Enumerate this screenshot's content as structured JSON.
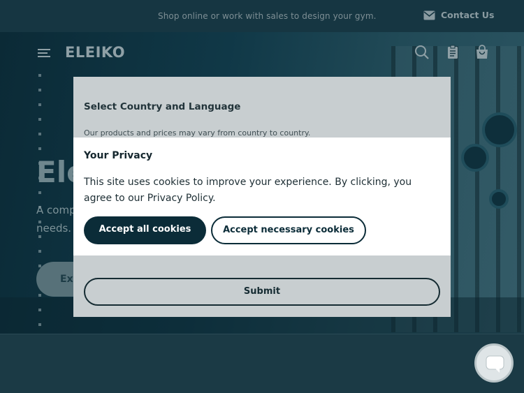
{
  "topbar": {
    "promo": "Shop online or work with sales to design your gym.",
    "contact_label": "Contact Us",
    "contact_icon": "envelope-icon"
  },
  "nav": {
    "logo": "ELEIKO",
    "menu_icon": "hamburger-menu-icon",
    "search_icon": "search-icon",
    "quote_icon": "clipboard-icon",
    "cart_icon": "shopping-bag-icon"
  },
  "hero": {
    "title": "Ele",
    "subtitle": "A comp needs.",
    "button_label": "Exp"
  },
  "country_modal": {
    "title": "Select Country and Language",
    "description": "Our products and prices may vary from country to country.",
    "submit_label": "Submit"
  },
  "privacy": {
    "title": "Your Privacy",
    "text": "This site uses cookies to improve your experience. By clicking, you agree to our Privacy Policy.",
    "accept_all_label": "Accept all cookies",
    "accept_necessary_label": "Accept necessary cookies"
  },
  "chat": {
    "icon": "chat-bubble-icon"
  }
}
